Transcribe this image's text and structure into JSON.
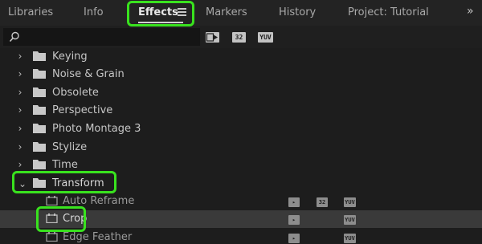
{
  "tabs": [
    {
      "label": "Libraries",
      "active": false
    },
    {
      "label": "Info",
      "active": false
    },
    {
      "label": "Effects",
      "active": true
    },
    {
      "label": "Markers",
      "active": false
    },
    {
      "label": "History",
      "active": false
    },
    {
      "label": "Project: Tutorial",
      "active": false
    }
  ],
  "overflow_glyph": "»",
  "search": {
    "placeholder": "",
    "value": ""
  },
  "filter_badges": {
    "accelerated": "▶",
    "bit32": "32",
    "yuv": "YUV"
  },
  "tree": {
    "folders": [
      {
        "label": "Keying",
        "expanded": false
      },
      {
        "label": "Noise & Grain",
        "expanded": false
      },
      {
        "label": "Obsolete",
        "expanded": false
      },
      {
        "label": "Perspective",
        "expanded": false
      },
      {
        "label": "Photo Montage 3",
        "expanded": false
      },
      {
        "label": "Stylize",
        "expanded": false
      },
      {
        "label": "Time",
        "expanded": false
      },
      {
        "label": "Transform",
        "expanded": true
      }
    ],
    "transform_children": [
      {
        "label": "Auto Reframe",
        "badges": [
          "accelerated",
          "32",
          "YUV"
        ],
        "selected": false
      },
      {
        "label": "Crop",
        "badges": [
          "accelerated",
          "YUV"
        ],
        "selected": true
      },
      {
        "label": "Edge Feather",
        "badges": [
          "accelerated",
          "YUV"
        ],
        "selected": false
      }
    ]
  },
  "colors": {
    "background": "#1d1d1d",
    "selection": "#3a3a3a",
    "highlight": "#39e21e"
  }
}
